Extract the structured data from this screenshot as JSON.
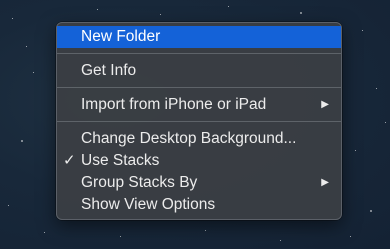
{
  "context_menu": {
    "items": [
      {
        "label": "New Folder"
      },
      {
        "label": "Get Info"
      },
      {
        "label": "Import from iPhone or iPad"
      },
      {
        "label": "Change Desktop Background..."
      },
      {
        "label": "Use Stacks",
        "checked": true
      },
      {
        "label": "Group Stacks By"
      },
      {
        "label": "Show View Options"
      }
    ],
    "check_glyph": "✓",
    "submenu_glyph": "▶"
  },
  "colors": {
    "highlight": "#1462d8",
    "menu_background": "#3a3e44",
    "text": "#ececec"
  }
}
